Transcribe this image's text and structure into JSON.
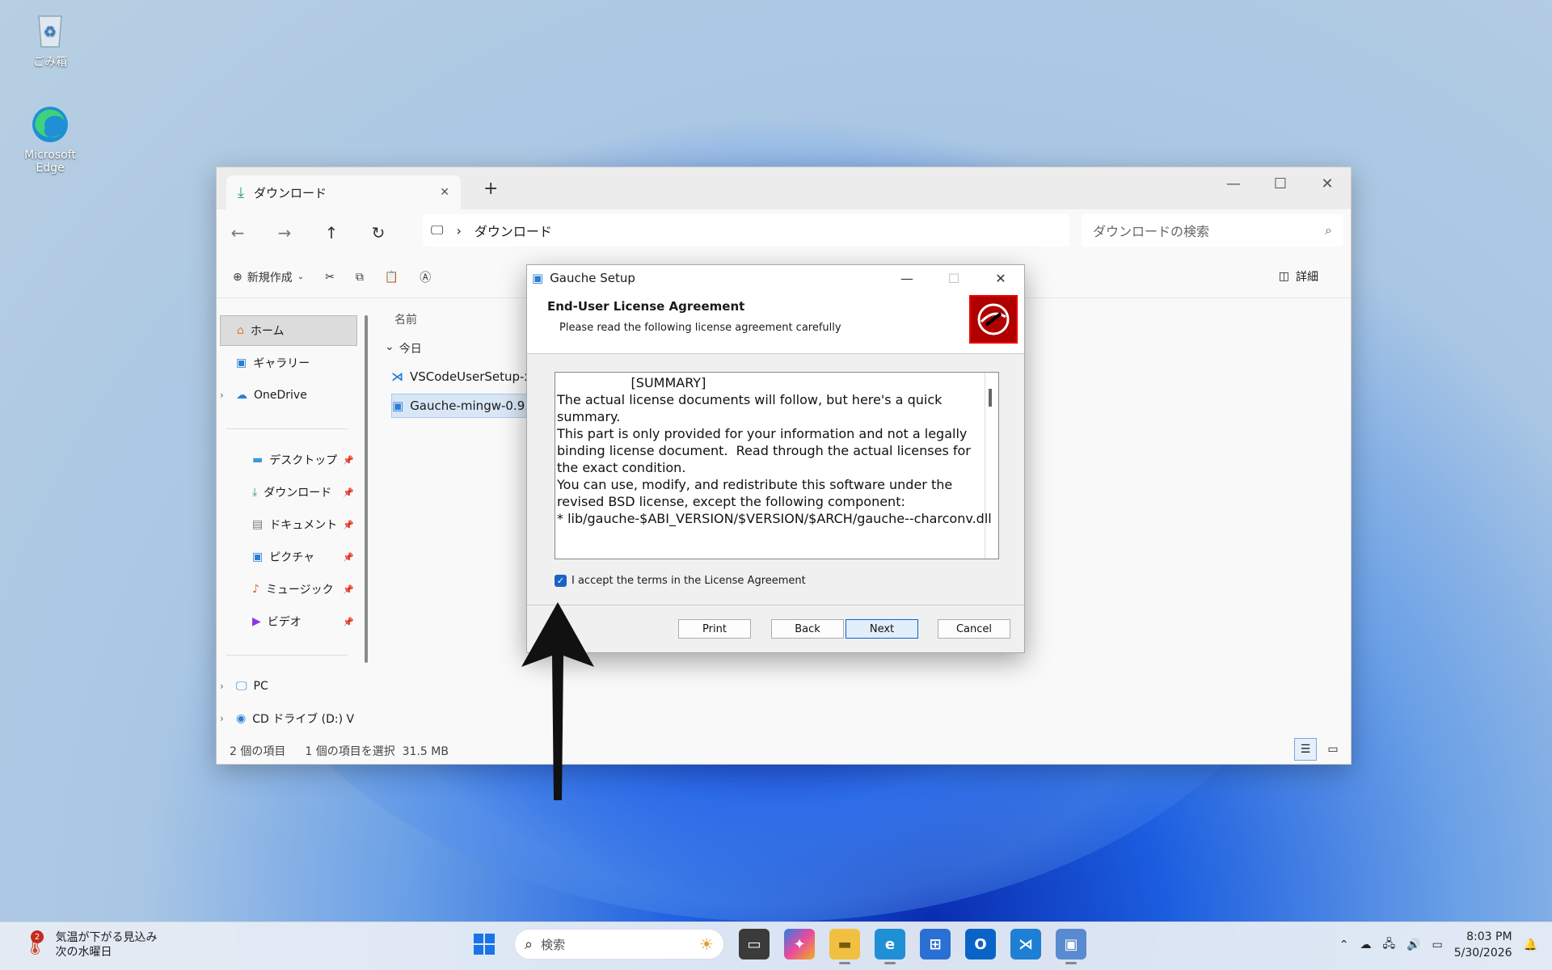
{
  "desktop": {
    "icons": [
      {
        "label": "ごみ箱",
        "icon": "recycle-bin-icon"
      },
      {
        "label": "Microsoft Edge",
        "icon": "edge-icon"
      }
    ]
  },
  "explorer": {
    "tab_title": "ダウンロード",
    "address": "ダウンロード",
    "search_placeholder": "ダウンロードの検索",
    "toolbar": {
      "new_label": "新規作成",
      "details_label": "詳細"
    },
    "sidebar": {
      "home": "ホーム",
      "gallery": "ギャラリー",
      "onedrive": "OneDrive",
      "desktop": "デスクトップ",
      "downloads": "ダウンロード",
      "documents": "ドキュメント",
      "pictures": "ピクチャ",
      "music": "ミュージック",
      "videos": "ビデオ",
      "pc": "PC",
      "cd_drive": "CD ドライブ (D:) V"
    },
    "column_name": "名前",
    "group_today": "今日",
    "files": [
      {
        "name": "VSCodeUserSetup-x6"
      },
      {
        "name": "Gauche-mingw-0.9.1"
      }
    ],
    "status": {
      "count": "2 個の項目",
      "selection": "1 個の項目を選択",
      "size": "31.5 MB"
    }
  },
  "dialog": {
    "title": "Gauche Setup",
    "heading": "End-User License Agreement",
    "subheading": "Please read the following license agreement carefully",
    "license_lines": [
      "                  [SUMMARY]",
      "",
      "The actual license documents will follow, but here's a quick summary.",
      "This part is only provided for your information and not a legally",
      "binding license document.  Read through the actual licenses for",
      "the exact condition.",
      "",
      "You can use, modify, and redistribute this software under the",
      "revised BSD license, except the following component:",
      "",
      "* lib/gauche-$ABI_VERSION/$VERSION/$ARCH/gauche--charconv.dll"
    ],
    "accept_label": "I accept the terms in the License Agreement",
    "buttons": {
      "print": "Print",
      "back": "Back",
      "next": "Next",
      "cancel": "Cancel"
    }
  },
  "taskbar": {
    "weather_line1": "気温が下がる見込み",
    "weather_line2": "次の水曜日",
    "weather_badge": "2",
    "search_placeholder": "検索",
    "time": "8:03 PM",
    "date": "5/30/2026"
  },
  "colors": {
    "accent": "#0a64c8",
    "checkbox": "#1a63c7",
    "gauche_logo": "#b00000"
  }
}
